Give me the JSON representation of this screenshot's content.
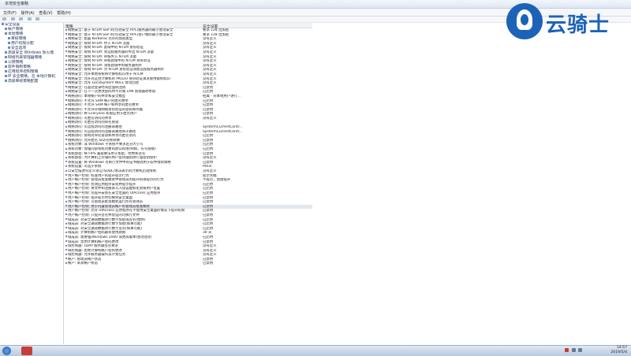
{
  "window": {
    "title": "本地安全策略",
    "menu": [
      "文件(F)",
      "操作(A)",
      "查看(V)",
      "帮助(H)"
    ]
  },
  "tree": [
    {
      "label": "安全设置",
      "level": 0
    },
    {
      "label": "帐户策略",
      "level": 1
    },
    {
      "label": "本地策略",
      "level": 1
    },
    {
      "label": "审核策略",
      "level": 2
    },
    {
      "label": "用户权限分配",
      "level": 2
    },
    {
      "label": "安全选项",
      "level": 2
    },
    {
      "label": "高级安全 Windows 防火墙",
      "level": 1
    },
    {
      "label": "网络列表管理器策略",
      "level": 1
    },
    {
      "label": "公钥策略",
      "level": 1
    },
    {
      "label": "软件限制策略",
      "level": 1
    },
    {
      "label": "应用程序控制策略",
      "level": 1
    },
    {
      "label": "IP 安全策略，在 本地计算机",
      "level": 1
    },
    {
      "label": "高级审核策略配置",
      "level": 1
    }
  ],
  "table": {
    "col_policy": "策略",
    "col_setting": "安全设置",
    "rows": [
      {
        "policy": "网络安全: 基于 NTLM SSP 的(包括安全 RPC)服务器的最小会话安全",
        "value": "要求 128 位加密"
      },
      {
        "policy": "网络安全: 基于 NTLM SSP 的(包括安全 RPC)客户端的最小会话安全",
        "value": "要求 128 位加密"
      },
      {
        "policy": "网络安全: 配置 Kerberos 允许的加密类型",
        "value": "没有定义"
      },
      {
        "policy": "网络安全: 限制 NTLM: 传入 NTLM 流量",
        "value": "没有定义"
      },
      {
        "policy": "网络安全: 限制 NTLM: 此域中的 NTLM 身份验证",
        "value": "没有定义"
      },
      {
        "policy": "网络安全: 限制 NTLM: 到远程服务器的传出 NTLM 流量",
        "value": "没有定义"
      },
      {
        "policy": "网络安全: 限制 NTLM: 审核传入 NTLM 流量",
        "value": "没有定义"
      },
      {
        "policy": "网络安全: 限制 NTLM: 审核此域中的 NTLM 身份验证",
        "value": "没有定义"
      },
      {
        "policy": "网络安全: 限制 NTLM: 添加此域中的服务器例外",
        "value": "没有定义"
      },
      {
        "policy": "网络安全: 限制 NTLM: 为 NTLM 身份验证添加远程服务器例外",
        "value": "没有定义"
      },
      {
        "policy": "网络安全: 允许本地系统将计算机标识用于 NTLM",
        "value": "没有定义"
      },
      {
        "policy": "网络安全: 允许对这台计算机的 PKU2U 身份验证请求使用联机标识",
        "value": "没有定义"
      },
      {
        "policy": "网络安全: 允许 LocalSystem NULL 会话回退",
        "value": "没有定义"
      },
      {
        "policy": "网络安全: 在超过登录时间后强制注销",
        "value": "已禁用"
      },
      {
        "policy": "网络安全: 在下一次更改密码时不存储 LAN 管理器哈希值",
        "value": "已启用"
      },
      {
        "policy": "网络访问: 本地帐户的共享和安全模型",
        "value": "经典 - 对本地用户进行..."
      },
      {
        "policy": "网络访问: 不允许 SAM 帐户的匿名枚举",
        "value": "已启用"
      },
      {
        "policy": "网络访问: 不允许 SAM 帐户和共享的匿名枚举",
        "value": "已禁用"
      },
      {
        "policy": "网络访问: 不允许存储网络身份验证的密码和凭据",
        "value": "已禁用"
      },
      {
        "policy": "网络访问: 将 Everyone 权限应用于匿名用户",
        "value": "已禁用"
      },
      {
        "policy": "网络访问: 可匿名访问的共享",
        "value": "没有定义"
      },
      {
        "policy": "网络访问: 可匿名访问的命名管道",
        "value": ""
      },
      {
        "policy": "网络访问: 可远程访问的注册表路径",
        "value": "System\\CurrentContr..."
      },
      {
        "policy": "网络访问: 可远程访问的注册表路径和子路径",
        "value": "System\\CurrentContr..."
      },
      {
        "policy": "网络访问: 限制对命名管道和共享的匿名访问",
        "value": "已启用"
      },
      {
        "policy": "网络访问: 允许匿名 SID/名称转换",
        "value": "已禁用"
      },
      {
        "policy": "系统对象: 非 Windows 子系统不要求区分大小写",
        "value": "已启用"
      },
      {
        "policy": "系统对象: 加强内部系统对象的默认权限(例如，符号链接)",
        "value": "已启用"
      },
      {
        "policy": "系统加密: 将 FIPS 兼容算法用于加密、哈希和签名",
        "value": "已禁用"
      },
      {
        "policy": "系统加密: 为计算机上存储的用户密钥强制进行强密钥保护",
        "value": "没有定义"
      },
      {
        "policy": "系统设置: 将 Windows 可执行文件中的证书规则用于软件限制策略",
        "value": "已禁用"
      },
      {
        "policy": "系统设置: 可选子系统",
        "value": "Posix"
      },
      {
        "policy": "以安全描述符定义语言(SDDL)语法表示的计算机启动限制",
        "value": "没有定义"
      },
      {
        "policy": "用户帐户控制: 标准用户的提升提示行为",
        "value": "提示凭据"
      },
      {
        "policy": "用户帐户控制: 管理员批准模式中管理员的提升权限提示的行为",
        "value": "不提示，直接提升"
      },
      {
        "policy": "用户帐户控制: 检测应用程序安装并提示提升",
        "value": "已启用"
      },
      {
        "policy": "用户帐户控制: 将文件和注册表写入错误虚拟化到每用户位置",
        "value": "已启用"
      },
      {
        "policy": "用户帐户控制: 仅提升安装在安全位置的 UIAccess 应用程序",
        "value": "已启用"
      },
      {
        "policy": "用户帐户控制: 提升提示时切换到安全桌面",
        "value": "已禁用"
      },
      {
        "policy": "用户帐户控制: 以管理员批准模式运行所有管理员",
        "value": "已禁用"
      },
      {
        "policy": "用户帐户控制: 用于内置管理员帐户的管理员批准模式",
        "value": "已禁用"
      },
      {
        "policy": "用户帐户控制: 允许 UIAccess 应用程序在不使用安全桌面的情况下提升权限",
        "value": "已禁用"
      },
      {
        "policy": "用户帐户控制: 只提升签名并验证的可执行文件",
        "value": "已禁用"
      },
      {
        "policy": "域成员: 对安全通道数据进行数字加密或签名(始终)",
        "value": "已启用"
      },
      {
        "policy": "域成员: 对安全通道数据进行数字加密(如果可能)",
        "value": "已启用"
      },
      {
        "policy": "域成员: 对安全通道数据进行数字签名(如果可能)",
        "value": "已启用"
      },
      {
        "policy": "域成员: 计算机帐户密码最长使用期限",
        "value": "30 天"
      },
      {
        "policy": "域成员: 需要强(Windows 2000 或更高版本)会话密钥",
        "value": "已启用"
      },
      {
        "policy": "域成员: 禁用计算机帐户密码更改",
        "value": "已禁用"
      },
      {
        "policy": "域控制器: LDAP 服务器签名要求",
        "value": "没有定义"
      },
      {
        "policy": "域控制器: 拒绝计算机帐户密码更改",
        "value": "没有定义"
      },
      {
        "policy": "域控制器: 允许服务器操作员计划任务",
        "value": "没有定义"
      },
      {
        "policy": "帐户: 管理员帐户状态",
        "value": "已禁用"
      },
      {
        "policy": "帐户: 来宾帐户状态",
        "value": "已禁用"
      }
    ]
  },
  "watermark": {
    "text": "云骑士"
  },
  "taskbar": {
    "time": "14:57",
    "date": "2019/5/4"
  }
}
